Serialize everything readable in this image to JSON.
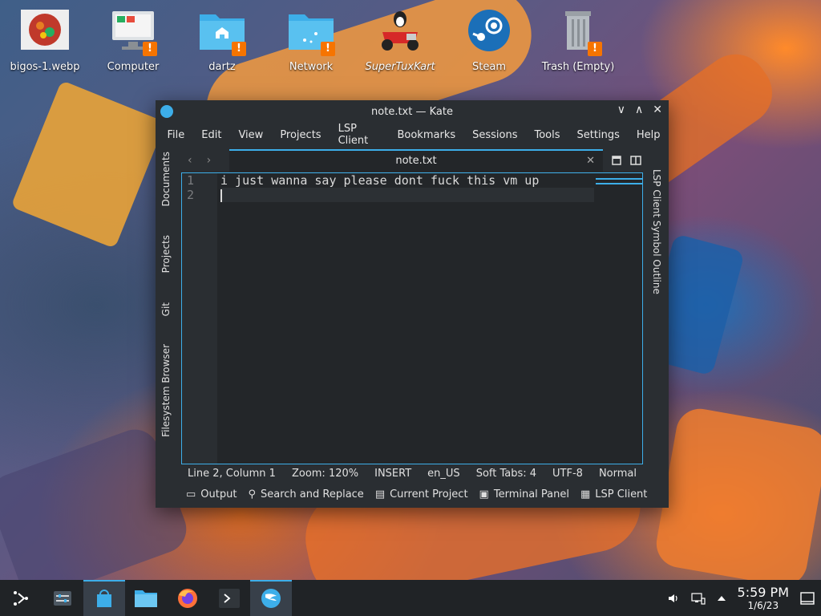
{
  "desktop": {
    "icons": [
      {
        "label": "bigos-1.webp"
      },
      {
        "label": "Computer"
      },
      {
        "label": "dartz"
      },
      {
        "label": "Network"
      },
      {
        "label": "SuperTuxKart"
      },
      {
        "label": "Steam"
      },
      {
        "label": "Trash (Empty)"
      }
    ],
    "badge_glyph": "!"
  },
  "window": {
    "title": "note.txt — Kate",
    "controls": {
      "minimize": "∨",
      "maximize": "∧",
      "close": "✕"
    },
    "menu": [
      "File",
      "Edit",
      "View",
      "Projects",
      "LSP Client",
      "Bookmarks",
      "Sessions",
      "Tools",
      "Settings",
      "Help"
    ],
    "left_panels": [
      "Documents",
      "Projects",
      "Git",
      "Filesystem Browser"
    ],
    "right_panels": [
      "LSP Client Symbol Outline"
    ],
    "tab": {
      "name": "note.txt",
      "close": "✕"
    },
    "nav": {
      "back": "‹",
      "forward": "›"
    },
    "editor": {
      "lines": [
        {
          "number": "1",
          "text": "i just wanna say please dont fuck this vm up"
        },
        {
          "number": "2",
          "text": ""
        }
      ]
    },
    "status": {
      "position": "Line 2, Column 1",
      "zoom": "Zoom: 120%",
      "mode": "INSERT",
      "language": "en_US",
      "indent": "Soft Tabs: 4",
      "encoding": "UTF-8",
      "syntax": "Normal"
    },
    "bottom_panels": [
      "Output",
      "Search and Replace",
      "Current Project",
      "Terminal Panel",
      "LSP Client"
    ]
  },
  "taskbar": {
    "clock_time": "5:59 PM",
    "clock_date": "1/6/23"
  },
  "colors": {
    "accent": "#3daee9",
    "warning": "#f67400",
    "window_bg": "#2a2e32",
    "editor_bg": "#232629"
  }
}
